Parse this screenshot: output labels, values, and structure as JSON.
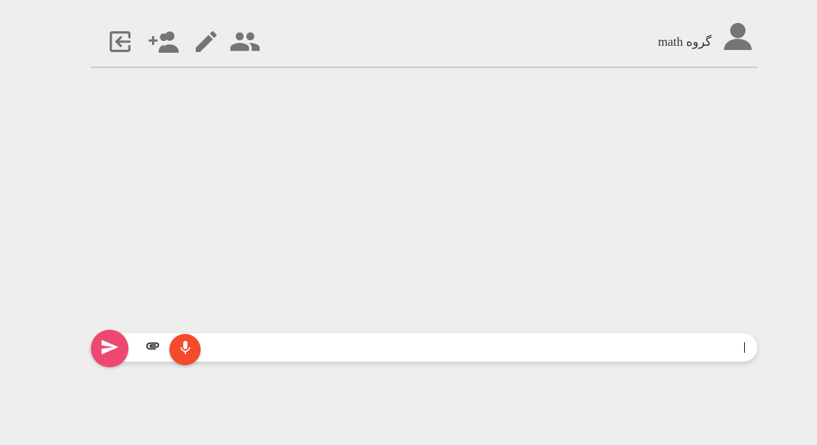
{
  "header": {
    "title": "math گروه",
    "icons": {
      "exit": "exit-icon",
      "add_member": "add-member-icon",
      "edit": "edit-icon",
      "members": "members-icon",
      "avatar": "user-avatar-icon"
    }
  },
  "composer": {
    "input_value": "",
    "send_icon": "send-icon",
    "attach_icon": "paperclip-icon",
    "mic_icon": "microphone-icon"
  },
  "colors": {
    "background": "#eeeeee",
    "icon_gray": "#757575",
    "send_button": "#ec4870",
    "mic_button": "#f44b2c",
    "composer_bg": "#ffffff"
  }
}
